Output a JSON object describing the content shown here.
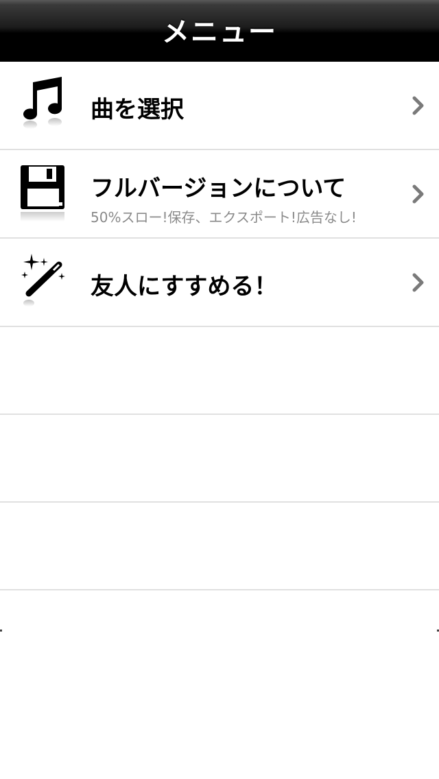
{
  "navbar": {
    "title": "メニュー"
  },
  "menu": {
    "items": [
      {
        "icon": "music-note-icon",
        "label": "曲を選択",
        "sublabel": ""
      },
      {
        "icon": "floppy-disk-icon",
        "label": "フルバージョンについて",
        "sublabel": "50%スロー!保存、エクスポート!広告なし!"
      },
      {
        "icon": "magic-wand-icon",
        "label": "友人にすすめる！",
        "sublabel": ""
      }
    ]
  },
  "colors": {
    "navbar_bg": "#000000",
    "navbar_text": "#ffffff",
    "separator": "#e0e0e0",
    "sublabel": "#8a8a8a",
    "chevron": "#7a7a7a"
  }
}
